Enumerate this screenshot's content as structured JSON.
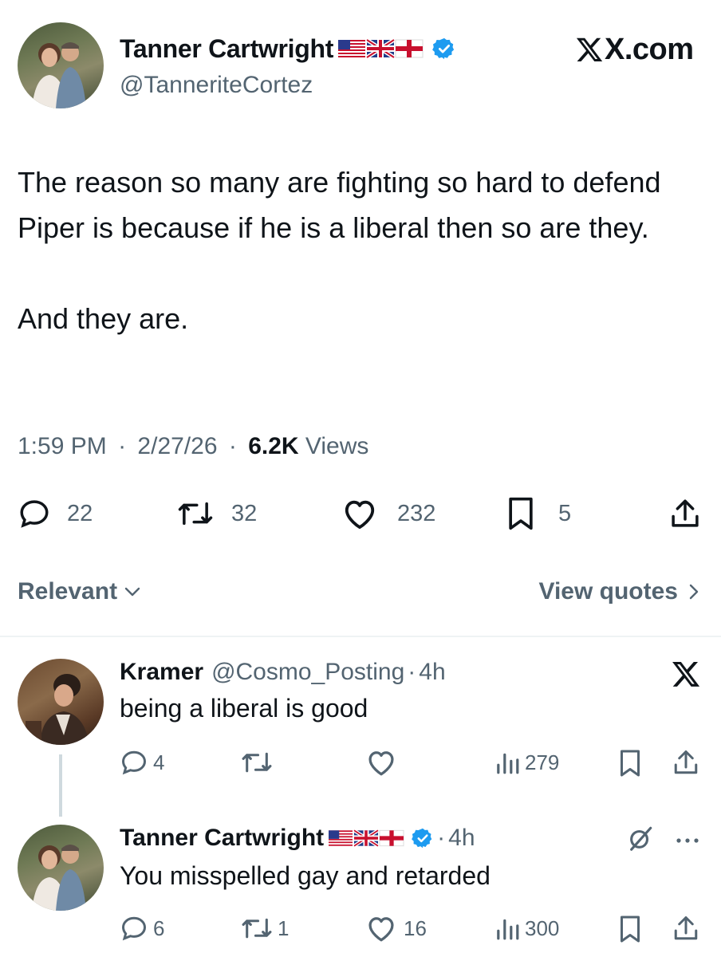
{
  "main_tweet": {
    "author_name": "Tanner Cartwright",
    "handle": "@TanneriteCortez",
    "source_label": "X.com",
    "body_paragraph_1": "The reason so many are fighting so hard to defend Piper is because if he is a liberal then so are they.",
    "body_paragraph_2": "And they are.",
    "time": "1:59 PM",
    "sep": "·",
    "date": "2/27/26",
    "views_count": "6.2K",
    "views_label": "Views",
    "replies": "22",
    "reposts": "32",
    "likes": "232",
    "bookmarks": "5"
  },
  "sort": {
    "label": "Relevant",
    "view_quotes": "View quotes"
  },
  "replies": [
    {
      "author_name": "Kramer",
      "handle": "@Cosmo_Posting",
      "sep": "·",
      "time": "4h",
      "text": "being a liberal is good",
      "replies": "4",
      "reposts": "",
      "likes": "",
      "views": "279"
    },
    {
      "author_name": "Tanner Cartwright",
      "sep": "·",
      "time": "4h",
      "text": "You misspelled gay and retarded",
      "replies": "6",
      "reposts": "1",
      "likes": "16",
      "views": "300"
    }
  ],
  "icons": {
    "reply": "speech-bubble-icon",
    "repost": "repost-arrows-icon",
    "like": "heart-icon",
    "bookmark": "bookmark-icon",
    "share": "share-upload-icon",
    "views": "bar-chart-icon",
    "verified": "verified-badge-icon",
    "x_logo": "x-logo-icon",
    "grok": "grok-slash-icon",
    "more": "more-dots-icon"
  },
  "colors": {
    "text": "#0f1419",
    "muted": "#536471",
    "verified_blue": "#1d9bf0",
    "divider": "#eff3f4"
  }
}
